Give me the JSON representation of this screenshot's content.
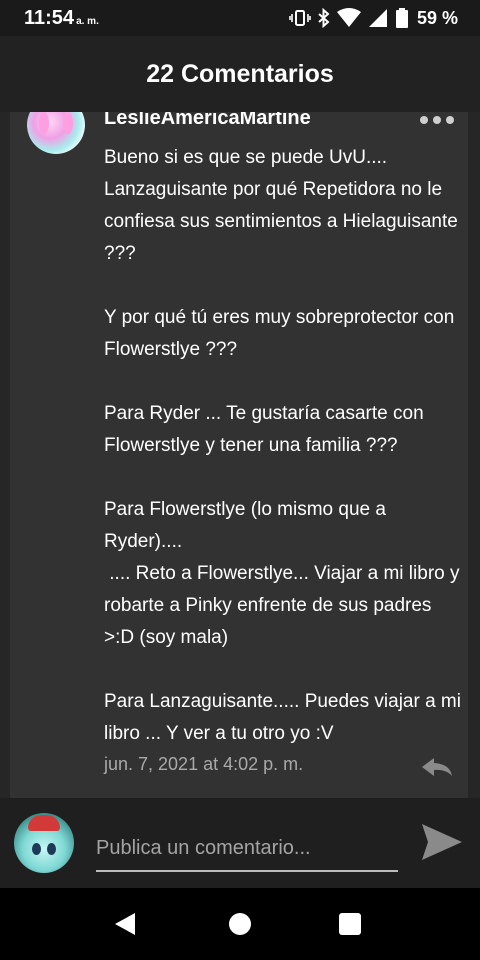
{
  "status_bar": {
    "time": "11:54",
    "ampm": "a. m.",
    "battery_percent": "59 %"
  },
  "header": {
    "title": "22 Comentarios"
  },
  "comment": {
    "author": "LeslieAmericaMartine",
    "paragraphs": [
      "Bueno si es que se puede UvU.... Lanzaguisante por qué Repetidora no le confiesa sus sentimientos a Hielaguisante ???",
      "Y por qué tú eres muy sobreprotector con Flowerstlye ???",
      "Para Ryder ... Te gustaría casarte con Flowerstlye y tener una familia ???",
      "Para Flowerstlye (lo mismo que a Ryder)....",
      " .... Reto a Flowerstlye... Viajar a mi libro y robarte a Pinky enfrente de sus padres >:D (soy mala)",
      "Para Lanzaguisante..... Puedes viajar a mi libro ... Y ver a tu otro yo :V"
    ],
    "timestamp": "jun. 7, 2021 at 4:02 p. m."
  },
  "composer": {
    "placeholder": "Publica un comentario..."
  },
  "icons": {
    "more": "more-horizontal-icon",
    "reply": "reply-icon",
    "send": "send-icon",
    "vibrate": "vibrate-icon",
    "bluetooth": "bluetooth-icon",
    "wifi": "wifi-icon",
    "signal": "signal-icon",
    "battery": "battery-icon",
    "nav_back": "back-triangle-icon",
    "nav_home": "home-circle-icon",
    "nav_recents": "recents-square-icon"
  },
  "colors": {
    "background": "#1c1c1c",
    "card": "#323232",
    "text": "#ffffff",
    "muted": "#a9a9a9"
  }
}
